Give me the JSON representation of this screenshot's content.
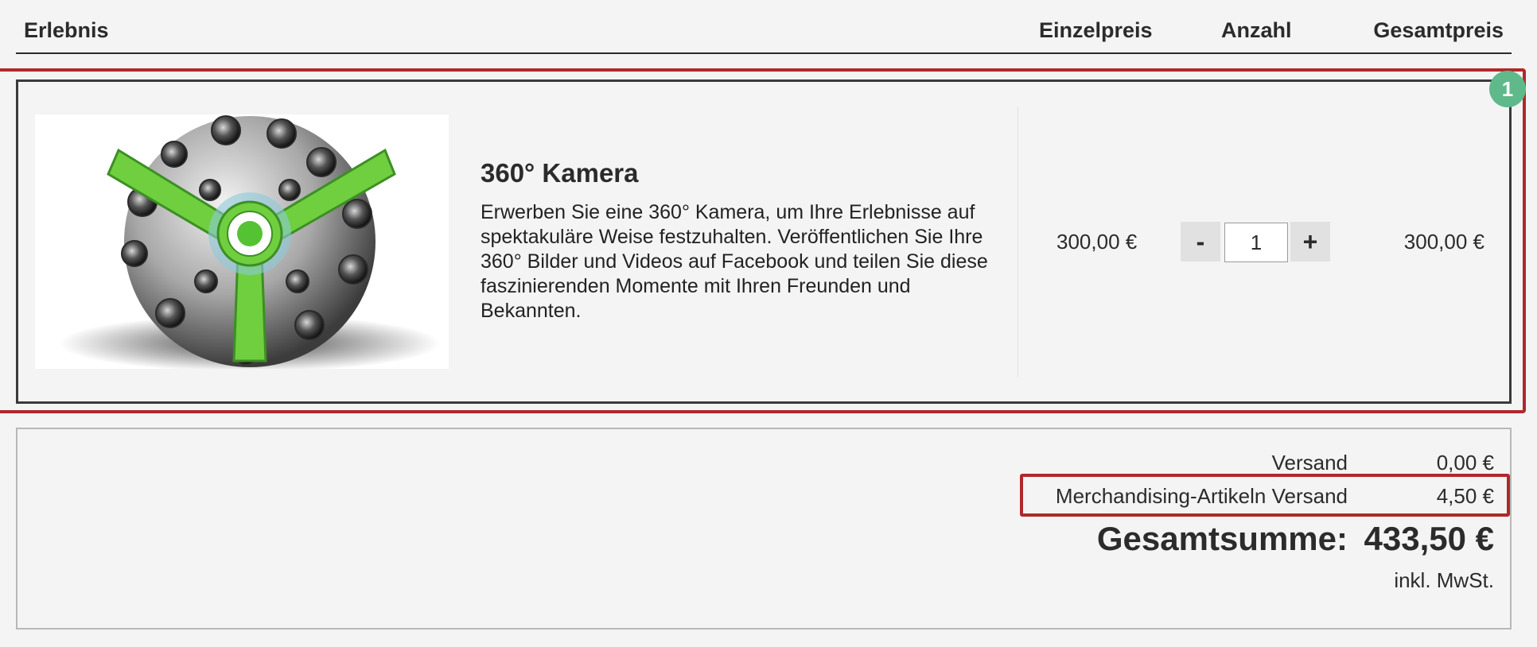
{
  "header": {
    "col_item": "Erlebnis",
    "col_unit_price": "Einzelpreis",
    "col_quantity": "Anzahl",
    "col_total": "Gesamtpreis"
  },
  "cart_item": {
    "badge": "1",
    "title": "360° Kamera",
    "description": "Erwerben Sie eine 360° Kamera, um Ihre Erlebnisse auf spektakuläre Weise festzuhalten. Veröffentlichen Sie Ihre 360° Bilder und Videos auf Facebook und teilen Sie diese faszinierenden Momente mit Ihren Freunden und Bekannten.",
    "unit_price": "300,00 €",
    "qty_minus": "-",
    "quantity": "1",
    "qty_plus": "+",
    "total_price": "300,00 €",
    "image_icon": "360-camera-ball-image"
  },
  "summary": {
    "shipping_label": "Versand",
    "shipping_value": "0,00 €",
    "merch_label": "Merchandising-Artikeln Versand",
    "merch_value": "4,50 €",
    "grand_label": "Gesamtsumme:",
    "grand_value": "433,50 €",
    "vat_note": "inkl. MwSt."
  },
  "colors": {
    "highlight": "#b0282b",
    "badge": "#5fb98a",
    "background": "#f4f4f4"
  }
}
